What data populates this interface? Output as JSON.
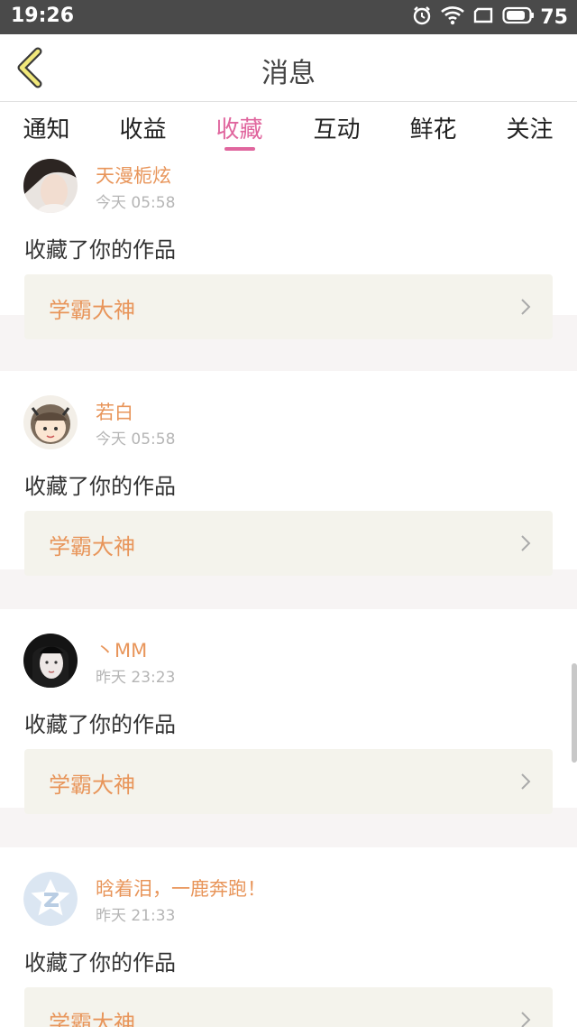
{
  "status_bar": {
    "time": "19:26",
    "battery": "75"
  },
  "header": {
    "title": "消息"
  },
  "tabs": [
    {
      "label": "通知"
    },
    {
      "label": "收益"
    },
    {
      "label": "收藏"
    },
    {
      "label": "互动"
    },
    {
      "label": "鲜花"
    },
    {
      "label": "关注"
    }
  ],
  "active_tab": "收藏",
  "colors": {
    "accent": "#e0669e",
    "nickname": "#e8955a",
    "box_bg": "#f4f3ec"
  },
  "items": [
    {
      "nickname": "天漫栀炫",
      "time": "今天 05:58",
      "action": "收藏了你的作品",
      "work": "学霸大神"
    },
    {
      "nickname": "若白",
      "time": "今天 05:58",
      "action": "收藏了你的作品",
      "work": "学霸大神"
    },
    {
      "nickname": "丶MM",
      "time": "昨天 23:23",
      "action": "收藏了你的作品",
      "work": "学霸大神"
    },
    {
      "nickname": "晗着泪，一鹿奔跑！",
      "time": "昨天 21:33",
      "action": "收藏了你的作品",
      "work": "学霸大神"
    }
  ]
}
